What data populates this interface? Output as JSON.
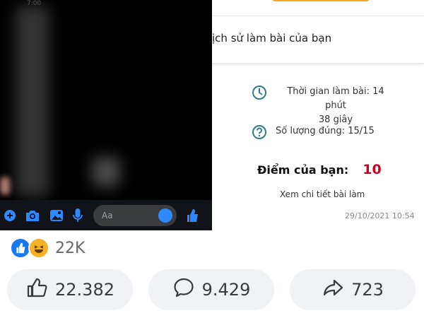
{
  "chat": {
    "top_label": "7:00",
    "composer_placeholder": "Aa",
    "icons": [
      "plus-icon",
      "camera-icon",
      "image-icon",
      "microphone-icon",
      "emoji-icon",
      "thumbs-up-icon"
    ],
    "accent_color": "#2e89ff"
  },
  "quiz": {
    "title": "ịch sử làm bài của bạn",
    "time_line1": "Thời gian làm bài: 14 phút",
    "time_line2": "38 giây",
    "correct_count": "Số lượng đúng: 15/15",
    "score_label": "Điểm của bạn:",
    "score_value": "10",
    "detail_link": "Xem chi tiết bài làm",
    "date": "29/10/2021 10:54",
    "score_color": "#d0021b"
  },
  "post": {
    "reaction_count": "22K",
    "reactions": [
      "like-reaction",
      "haha-reaction"
    ],
    "likes": "22.382",
    "comments": "9.429",
    "shares": "723"
  }
}
